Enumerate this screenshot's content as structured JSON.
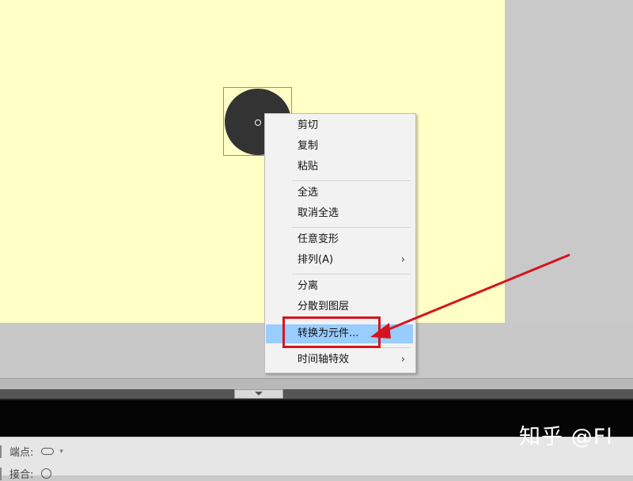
{
  "context_menu": {
    "items": [
      {
        "label": "剪切"
      },
      {
        "label": "复制"
      },
      {
        "label": "粘贴"
      },
      {
        "label": "全选"
      },
      {
        "label": "取消全选"
      },
      {
        "label": "任意变形"
      },
      {
        "label": "排列(A)",
        "submenu": true
      },
      {
        "label": "分离"
      },
      {
        "label": "分散到图层"
      },
      {
        "label": "转换为元件...",
        "highlighted": true
      },
      {
        "label": "时间轴特效",
        "submenu": true
      }
    ],
    "submenu_glyph": "›",
    "highlight_color": "#99ccff"
  },
  "stage": {
    "background_color": "#ffffc6",
    "shape": "circle",
    "shape_color": "#333333"
  },
  "annotation": {
    "color": "#d6141e",
    "target": "转换为元件..."
  },
  "properties": {
    "cap_label": "端点:",
    "join_label": "接合:"
  },
  "watermark": "知乎 @Fl"
}
